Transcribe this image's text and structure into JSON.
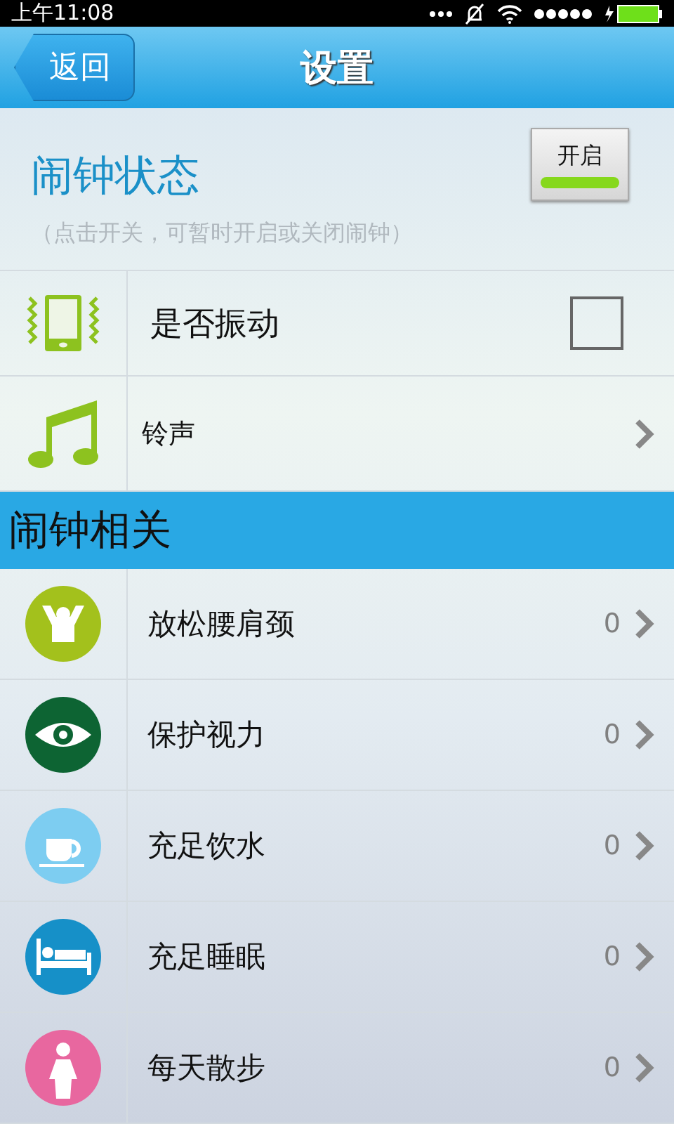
{
  "status_bar": {
    "time": "上午11:08"
  },
  "header": {
    "back": "返回",
    "title": "设置"
  },
  "alarm_status": {
    "title": "闹钟状态",
    "hint": "（点击开关，可暂时开启或关闭闹钟）",
    "toggle": {
      "label": "开启",
      "on": true
    }
  },
  "settings": [
    {
      "kind": "vibrate",
      "label": "是否振动",
      "checked": false
    },
    {
      "kind": "ringtone",
      "label": "铃声"
    }
  ],
  "section": {
    "title": "闹钟相关"
  },
  "alarms": [
    {
      "kind": "relax",
      "label": "放松腰肩颈",
      "count": "0",
      "color": "#a3c11c"
    },
    {
      "kind": "eye",
      "label": "保护视力",
      "count": "0",
      "color": "#0d6433"
    },
    {
      "kind": "cup",
      "label": "充足饮水",
      "count": "0",
      "color": "#7dcdf1"
    },
    {
      "kind": "bed",
      "label": "充足睡眠",
      "count": "0",
      "color": "#1690c8"
    },
    {
      "kind": "walk",
      "label": "每天散步",
      "count": "0",
      "color": "#e8679f"
    }
  ]
}
